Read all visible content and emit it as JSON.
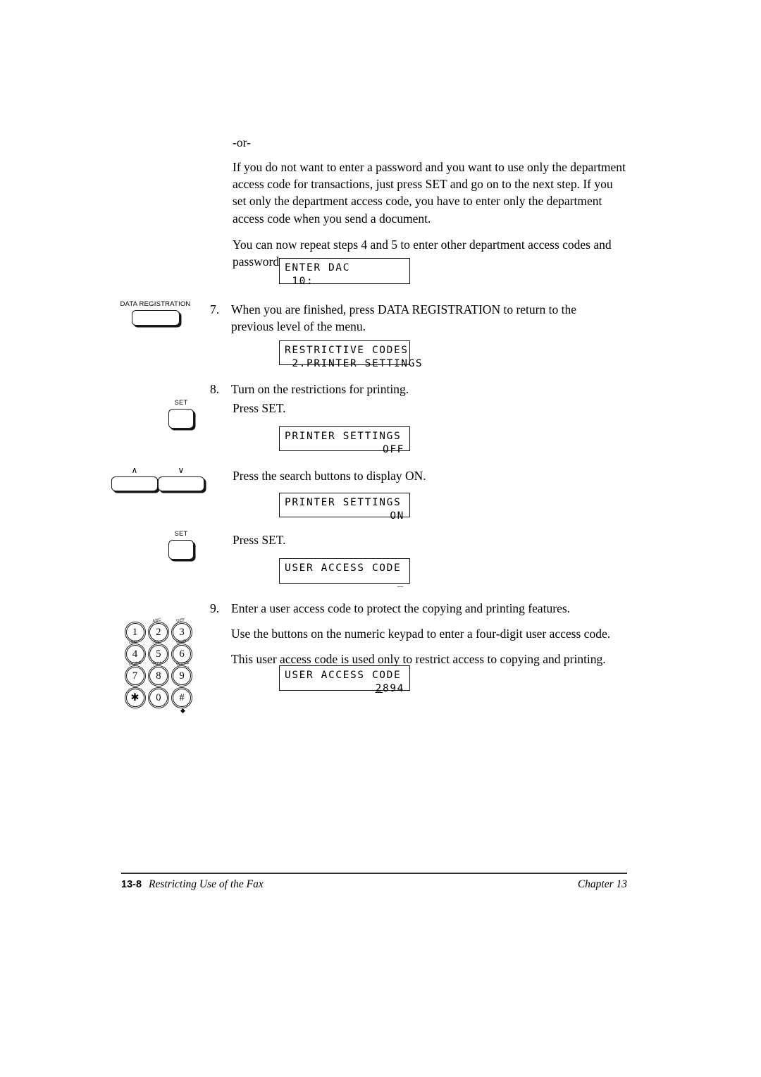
{
  "body": {
    "or_marker": "-or-",
    "paragraph_password": "If you do not want to enter a password and you want to use only the department access code for transactions, just press SET and go on to the next step. If you set only the department access code, you have to enter only the department access code when you send a document.",
    "paragraph_repeat": "You can now repeat steps 4 and 5 to enter other department access codes and passwords."
  },
  "steps": {
    "step7": {
      "number": "7.",
      "text": "When you are finished, press DATA REGISTRATION to return to the previous level of the menu."
    },
    "step8": {
      "number": "8.",
      "text": "Turn on the restrictions for printing.",
      "press_set_1": "Press SET.",
      "press_search": "Press the search buttons to display ON.",
      "press_set_2": "Press SET."
    },
    "step9": {
      "number": "9.",
      "text": "Enter a user access code to protect the copying and printing features.",
      "line2": "Use the buttons on the numeric keypad to enter a four-digit user access code.",
      "line3": "This user access code is used only to restrict access to copying and printing."
    }
  },
  "displays": {
    "enter_dac": {
      "line1": "ENTER DAC",
      "line2": " 10:"
    },
    "restrictive_codes": {
      "line1": "RESTRICTIVE CODES",
      "line2": " 2.PRINTER SETTINGS"
    },
    "printer_settings_off": {
      "line1": "PRINTER SETTINGS",
      "line2": "OFF"
    },
    "printer_settings_on": {
      "line1": "PRINTER SETTINGS",
      "line2": "ON"
    },
    "user_access_code_empty": {
      "line1": "USER ACCESS CODE",
      "line2": "_"
    },
    "user_access_code_filled": {
      "line1": "USER ACCESS CODE",
      "cursor_digit": "2",
      "rest_digits": "894"
    }
  },
  "controls": {
    "data_registration": {
      "label": "DATA REGISTRATION"
    },
    "set_button_1": {
      "label": "SET"
    },
    "set_button_2": {
      "label": "SET"
    },
    "search_up": {
      "label": "∧"
    },
    "search_down": {
      "label": "∨"
    }
  },
  "keypad": {
    "keys": [
      {
        "digit": "1",
        "letters": ""
      },
      {
        "digit": "2",
        "letters": "ABC"
      },
      {
        "digit": "3",
        "letters": "DEF"
      },
      {
        "digit": "4",
        "letters": "GHI"
      },
      {
        "digit": "5",
        "letters": "JKL"
      },
      {
        "digit": "6",
        "letters": "MNO"
      },
      {
        "digit": "7",
        "letters": "PQRS"
      },
      {
        "digit": "8",
        "letters": "TUV"
      },
      {
        "digit": "9",
        "letters": "WXYZ"
      },
      {
        "digit": "✱",
        "letters": ""
      },
      {
        "digit": "0",
        "letters": ""
      },
      {
        "digit": "#",
        "letters": ""
      }
    ]
  },
  "footer": {
    "page_number": "13-8",
    "section_title": "Restricting Use of the Fax",
    "chapter": "Chapter 13"
  }
}
